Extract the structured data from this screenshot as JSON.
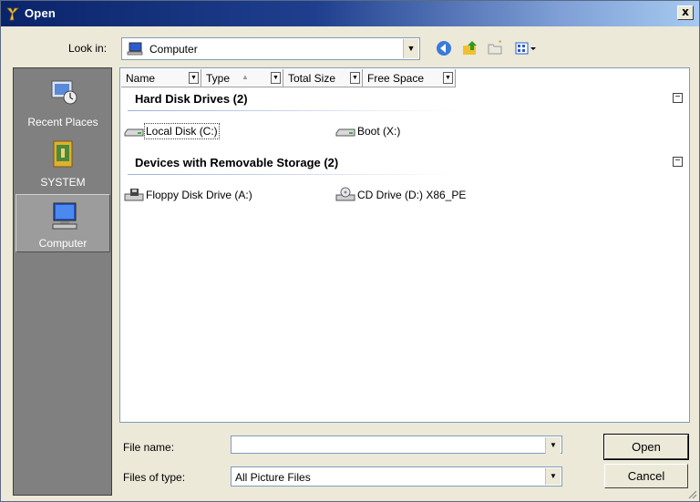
{
  "window": {
    "title": "Open",
    "close_symbol": "x"
  },
  "toolbar": {
    "look_in_label": "Look in:",
    "look_in_value": "Computer",
    "icons": [
      "back-icon",
      "up-folder-icon",
      "new-folder-icon",
      "views-menu-icon"
    ]
  },
  "places": [
    {
      "label": "Recent Places",
      "icon": "recent-places-icon",
      "selected": false
    },
    {
      "label": "SYSTEM",
      "icon": "user-folder-icon",
      "selected": false
    },
    {
      "label": "Computer",
      "icon": "computer-icon",
      "selected": true
    }
  ],
  "columns": [
    "Name",
    "Type",
    "Total Size",
    "Free Space"
  ],
  "groups": [
    {
      "title": "Hard Disk Drives (2)",
      "collapse_symbol": "−",
      "items": [
        {
          "label": "Local Disk (C:)",
          "icon": "hard-disk-icon",
          "focused": true
        },
        {
          "label": "Boot (X:)",
          "icon": "hard-disk-icon",
          "focused": false
        }
      ]
    },
    {
      "title": "Devices with Removable Storage (2)",
      "collapse_symbol": "−",
      "items": [
        {
          "label": "Floppy Disk Drive (A:)",
          "icon": "floppy-drive-icon",
          "focused": false
        },
        {
          "label": "CD Drive (D:) X86_PE",
          "icon": "cd-drive-icon",
          "focused": false
        }
      ]
    }
  ],
  "footer": {
    "file_name_label": "File name:",
    "file_name_value": "",
    "files_of_type_label": "Files of type:",
    "files_of_type_value": "All Picture Files",
    "open_button": "Open",
    "cancel_button": "Cancel"
  }
}
